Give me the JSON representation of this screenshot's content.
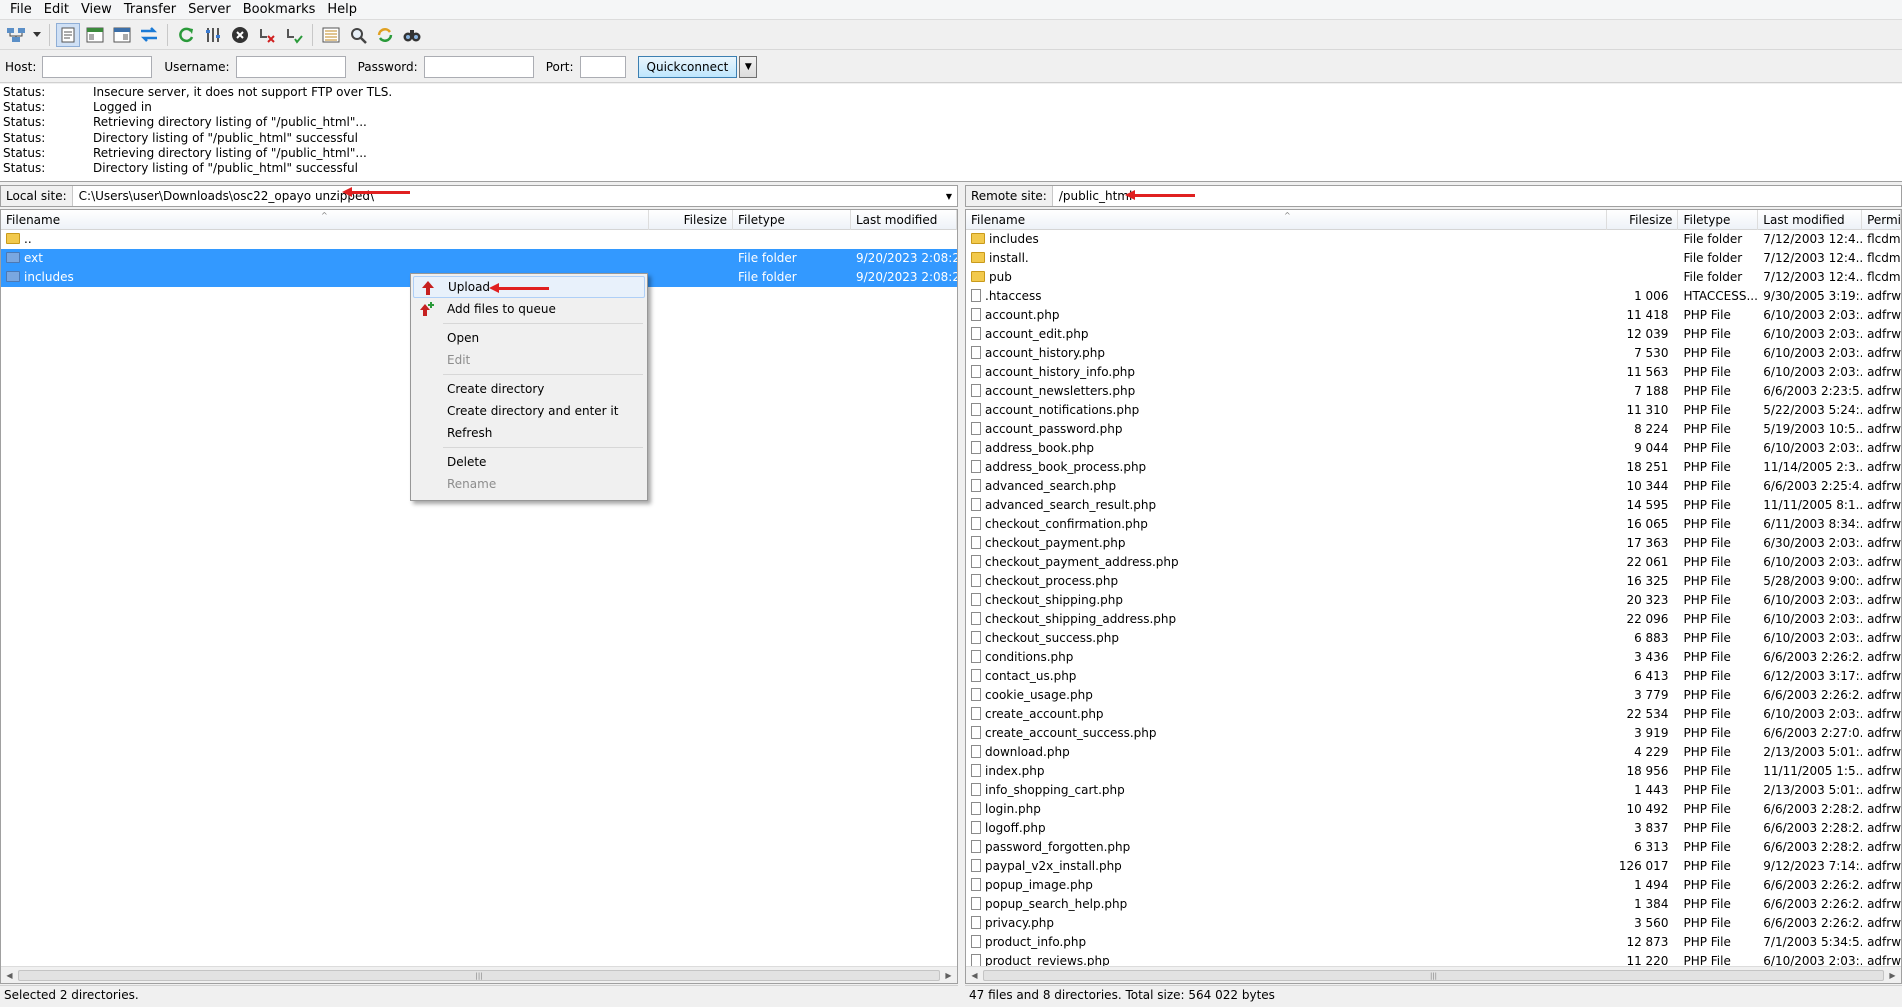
{
  "menu": [
    "File",
    "Edit",
    "View",
    "Transfer",
    "Server",
    "Bookmarks",
    "Help"
  ],
  "toolbar_icons": [
    "site-manager-icon",
    "dropdown-icon",
    "toggle-log-icon",
    "toggle-local-tree-icon",
    "toggle-remote-tree-icon",
    "toggle-queue-icon",
    "refresh-icon",
    "process-queue-icon",
    "cancel-icon",
    "disconnect-icon",
    "reconnect-icon",
    "directory-comparison-icon",
    "filter-icon",
    "sync-browse-icon",
    "search-icon"
  ],
  "quickconnect": {
    "host_label": "Host:",
    "user_label": "Username:",
    "pass_label": "Password:",
    "port_label": "Port:",
    "button": "Quickconnect",
    "host_value": "",
    "user_value": "",
    "pass_value": "",
    "port_value": ""
  },
  "log": [
    {
      "k": "Status:",
      "v": "Insecure server, it does not support FTP over TLS."
    },
    {
      "k": "Status:",
      "v": "Logged in"
    },
    {
      "k": "Status:",
      "v": "Retrieving directory listing of \"/public_html\"..."
    },
    {
      "k": "Status:",
      "v": "Directory listing of \"/public_html\" successful"
    },
    {
      "k": "Status:",
      "v": "Retrieving directory listing of \"/public_html\"..."
    },
    {
      "k": "Status:",
      "v": "Directory listing of \"/public_html\" successful"
    }
  ],
  "local": {
    "label": "Local site:",
    "path": "C:\\Users\\user\\Downloads\\osc22_opayo unzipped\\",
    "cols": [
      "Filename",
      "Filesize",
      "Filetype",
      "Last modified"
    ],
    "rows": [
      {
        "name": "..",
        "size": "",
        "type": "",
        "mod": "",
        "sel": false
      },
      {
        "name": "ext",
        "size": "",
        "type": "File folder",
        "mod": "9/20/2023 2:08:23 ...",
        "sel": true
      },
      {
        "name": "includes",
        "size": "",
        "type": "File folder",
        "mod": "9/20/2023 2:08:24 ...",
        "sel": true
      }
    ],
    "status": "Selected 2 directories."
  },
  "remote": {
    "label": "Remote site:",
    "path": "/public_html",
    "cols": [
      "Filename",
      "Filesize",
      "Filetype",
      "Last modified",
      "Permi"
    ],
    "rows": [
      {
        "name": "includes",
        "size": "",
        "type": "File folder",
        "mod": "7/12/2003 12:4...",
        "perm": "flcdm",
        "folder": true
      },
      {
        "name": "install.",
        "size": "",
        "type": "File folder",
        "mod": "7/12/2003 12:4...",
        "perm": "flcdm",
        "folder": true
      },
      {
        "name": "pub",
        "size": "",
        "type": "File folder",
        "mod": "7/12/2003 12:4...",
        "perm": "flcdm",
        "folder": true
      },
      {
        "name": ".htaccess",
        "size": "1 006",
        "type": "HTACCESS...",
        "mod": "9/30/2005 3:19:...",
        "perm": "adfrw"
      },
      {
        "name": "account.php",
        "size": "11 418",
        "type": "PHP File",
        "mod": "6/10/2003 2:03:...",
        "perm": "adfrw"
      },
      {
        "name": "account_edit.php",
        "size": "12 039",
        "type": "PHP File",
        "mod": "6/10/2003 2:03:...",
        "perm": "adfrw"
      },
      {
        "name": "account_history.php",
        "size": "7 530",
        "type": "PHP File",
        "mod": "6/10/2003 2:03:...",
        "perm": "adfrw"
      },
      {
        "name": "account_history_info.php",
        "size": "11 563",
        "type": "PHP File",
        "mod": "6/10/2003 2:03:...",
        "perm": "adfrw"
      },
      {
        "name": "account_newsletters.php",
        "size": "7 188",
        "type": "PHP File",
        "mod": "6/6/2003 2:23:5...",
        "perm": "adfrw"
      },
      {
        "name": "account_notifications.php",
        "size": "11 310",
        "type": "PHP File",
        "mod": "5/22/2003 5:24:...",
        "perm": "adfrw"
      },
      {
        "name": "account_password.php",
        "size": "8 224",
        "type": "PHP File",
        "mod": "5/19/2003 10:5...",
        "perm": "adfrw"
      },
      {
        "name": "address_book.php",
        "size": "9 044",
        "type": "PHP File",
        "mod": "6/10/2003 2:03:...",
        "perm": "adfrw"
      },
      {
        "name": "address_book_process.php",
        "size": "18 251",
        "type": "PHP File",
        "mod": "11/14/2005 2:3...",
        "perm": "adfrw"
      },
      {
        "name": "advanced_search.php",
        "size": "10 344",
        "type": "PHP File",
        "mod": "6/6/2003 2:25:4...",
        "perm": "adfrw"
      },
      {
        "name": "advanced_search_result.php",
        "size": "14 595",
        "type": "PHP File",
        "mod": "11/11/2005 8:1...",
        "perm": "adfrw"
      },
      {
        "name": "checkout_confirmation.php",
        "size": "16 065",
        "type": "PHP File",
        "mod": "6/11/2003 8:34:...",
        "perm": "adfrw"
      },
      {
        "name": "checkout_payment.php",
        "size": "17 363",
        "type": "PHP File",
        "mod": "6/30/2003 2:03:...",
        "perm": "adfrw"
      },
      {
        "name": "checkout_payment_address.php",
        "size": "22 061",
        "type": "PHP File",
        "mod": "6/10/2003 2:03:...",
        "perm": "adfrw"
      },
      {
        "name": "checkout_process.php",
        "size": "16 325",
        "type": "PHP File",
        "mod": "5/28/2003 9:00:...",
        "perm": "adfrw"
      },
      {
        "name": "checkout_shipping.php",
        "size": "20 323",
        "type": "PHP File",
        "mod": "6/10/2003 2:03:...",
        "perm": "adfrw"
      },
      {
        "name": "checkout_shipping_address.php",
        "size": "22 096",
        "type": "PHP File",
        "mod": "6/10/2003 2:03:...",
        "perm": "adfrw"
      },
      {
        "name": "checkout_success.php",
        "size": "6 883",
        "type": "PHP File",
        "mod": "6/10/2003 2:03:...",
        "perm": "adfrw"
      },
      {
        "name": "conditions.php",
        "size": "3 436",
        "type": "PHP File",
        "mod": "6/6/2003 2:26:2...",
        "perm": "adfrw"
      },
      {
        "name": "contact_us.php",
        "size": "6 413",
        "type": "PHP File",
        "mod": "6/12/2003 3:17:...",
        "perm": "adfrw"
      },
      {
        "name": "cookie_usage.php",
        "size": "3 779",
        "type": "PHP File",
        "mod": "6/6/2003 2:26:2...",
        "perm": "adfrw"
      },
      {
        "name": "create_account.php",
        "size": "22 534",
        "type": "PHP File",
        "mod": "6/10/2003 2:03:...",
        "perm": "adfrw"
      },
      {
        "name": "create_account_success.php",
        "size": "3 919",
        "type": "PHP File",
        "mod": "6/6/2003 2:27:0...",
        "perm": "adfrw"
      },
      {
        "name": "download.php",
        "size": "4 229",
        "type": "PHP File",
        "mod": "2/13/2003 5:01:...",
        "perm": "adfrw"
      },
      {
        "name": "index.php",
        "size": "18 956",
        "type": "PHP File",
        "mod": "11/11/2005 1:5...",
        "perm": "adfrw"
      },
      {
        "name": "info_shopping_cart.php",
        "size": "1 443",
        "type": "PHP File",
        "mod": "2/13/2003 5:01:...",
        "perm": "adfrw"
      },
      {
        "name": "login.php",
        "size": "10 492",
        "type": "PHP File",
        "mod": "6/6/2003 2:28:2...",
        "perm": "adfrw"
      },
      {
        "name": "logoff.php",
        "size": "3 837",
        "type": "PHP File",
        "mod": "6/6/2003 2:28:2...",
        "perm": "adfrw"
      },
      {
        "name": "password_forgotten.php",
        "size": "6 313",
        "type": "PHP File",
        "mod": "6/6/2003 2:28:2...",
        "perm": "adfrw"
      },
      {
        "name": "paypal_v2x_install.php",
        "size": "126 017",
        "type": "PHP File",
        "mod": "9/12/2023 7:14:...",
        "perm": "adfrw"
      },
      {
        "name": "popup_image.php",
        "size": "1 494",
        "type": "PHP File",
        "mod": "6/6/2003 2:26:2...",
        "perm": "adfrw"
      },
      {
        "name": "popup_search_help.php",
        "size": "1 384",
        "type": "PHP File",
        "mod": "6/6/2003 2:26:2...",
        "perm": "adfrw"
      },
      {
        "name": "privacy.php",
        "size": "3 560",
        "type": "PHP File",
        "mod": "6/6/2003 2:26:2...",
        "perm": "adfrw"
      },
      {
        "name": "product_info.php",
        "size": "12 873",
        "type": "PHP File",
        "mod": "7/1/2003 5:34:5...",
        "perm": "adfrw"
      },
      {
        "name": "product_reviews.php",
        "size": "11 220",
        "type": "PHP File",
        "mod": "6/10/2003 2:03:...",
        "perm": "adfrw"
      }
    ],
    "status": "47 files and 8 directories. Total size: 564 022 bytes"
  },
  "context_menu": [
    {
      "label": "Upload",
      "icon": "upload-icon",
      "hl": true
    },
    {
      "label": "Add files to queue",
      "icon": "add-to-queue-icon"
    },
    {
      "sep": true
    },
    {
      "label": "Open"
    },
    {
      "label": "Edit",
      "disabled": true
    },
    {
      "sep": true
    },
    {
      "label": "Create directory"
    },
    {
      "label": "Create directory and enter it"
    },
    {
      "label": "Refresh"
    },
    {
      "sep": true
    },
    {
      "label": "Delete"
    },
    {
      "label": "Rename",
      "disabled": true
    }
  ],
  "colors": {
    "selection": "#3399ff",
    "annotation_arrow": "#e02020"
  }
}
